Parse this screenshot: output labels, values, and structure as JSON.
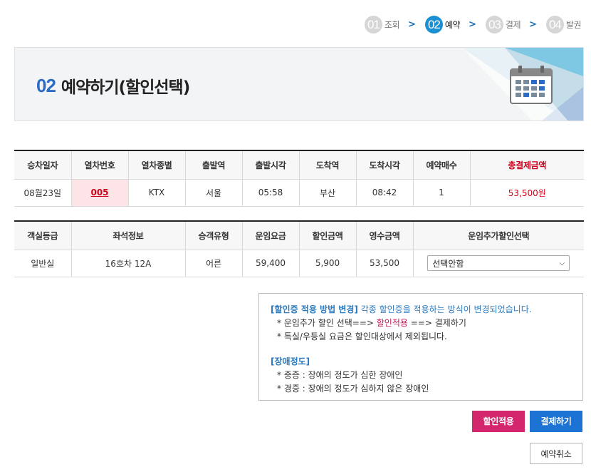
{
  "steps": [
    {
      "num": "01",
      "label": "조회",
      "active": false
    },
    {
      "num": "02",
      "label": "예약",
      "active": true
    },
    {
      "num": "03",
      "label": "결제",
      "active": false
    },
    {
      "num": "04",
      "label": "발권",
      "active": false
    }
  ],
  "step_arrow": ">",
  "banner": {
    "num": "02",
    "title": "예약하기(할인선택)"
  },
  "table1": {
    "headers": [
      "승차일자",
      "열차번호",
      "열차종별",
      "출발역",
      "출발시각",
      "도착역",
      "도착시각",
      "예약매수",
      "총결제금액"
    ],
    "row": [
      "08월23일",
      "005",
      "KTX",
      "서울",
      "05:58",
      "부산",
      "08:42",
      "1",
      "53,500원"
    ]
  },
  "table2": {
    "headers": [
      "객실등급",
      "좌석정보",
      "승객유형",
      "운임요금",
      "할인금액",
      "영수금액",
      "운임추가할인선택"
    ],
    "row": [
      "일반실",
      "16호차 12A",
      "어른",
      "59,400",
      "5,900",
      "53,500"
    ],
    "select_value": "선택안함"
  },
  "notice": {
    "title1": "[할인증 적용 방법 변경]",
    "title1_desc": " 각종 할인증을 적용하는 방식이 변경되었습니다.",
    "line1_a": "* 운임추가 할인 선택==> ",
    "line1_b": "할인적용",
    "line1_c": " ==> 결제하기",
    "line2": "* 특실/우등실 요금은 할인대상에서 제외됩니다.",
    "title2": "[장애정도]",
    "line3": "* 중증 : 장애의 정도가 심한 장애인",
    "line4": "* 경증 : 장애의 정도가 심하지 않은 장애인"
  },
  "buttons": {
    "discount": "할인적용",
    "pay": "결제하기",
    "cancel": "예약취소"
  },
  "colors": {
    "accent_blue": "#1a8fd1",
    "accent_red": "#d0021b",
    "pink": "#d4266d",
    "pay_blue": "#1c73d4"
  }
}
